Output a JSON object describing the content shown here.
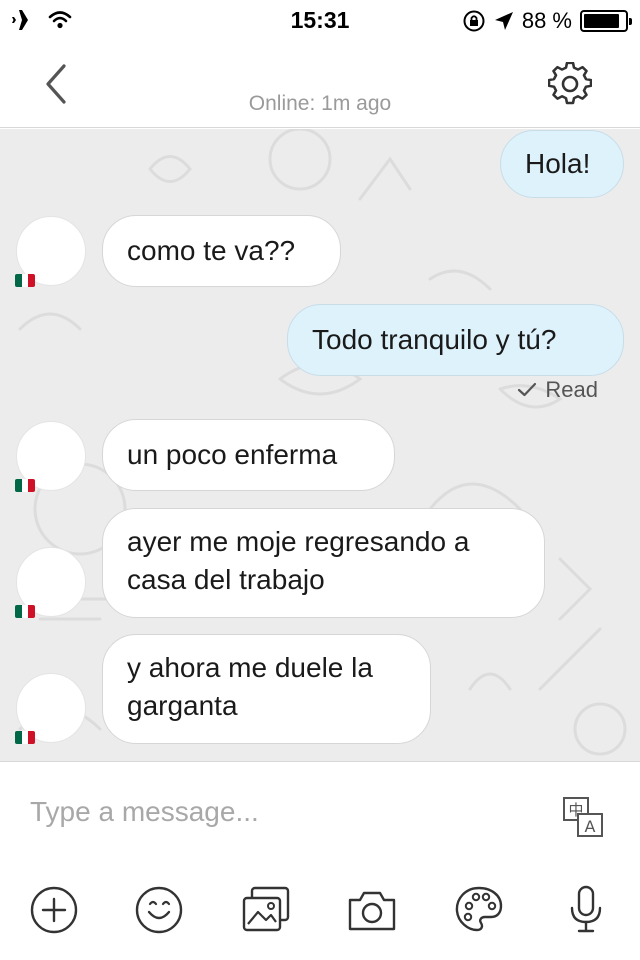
{
  "status_bar": {
    "time": "15:31",
    "battery_text": "88 %",
    "battery_level": 0.88,
    "icons": [
      "airplane-icon",
      "wifi-icon",
      "rotation-lock-icon",
      "location-arrow-icon",
      "battery-icon"
    ]
  },
  "header": {
    "status": "Online: 1m ago",
    "icons": [
      "chevron-left-icon",
      "gear-icon"
    ]
  },
  "messages": [
    {
      "direction": "out",
      "text": "Hola!"
    },
    {
      "direction": "in",
      "text": "como te va??"
    },
    {
      "direction": "out",
      "text": "Todo tranquilo y tú?"
    },
    {
      "direction": "in",
      "text": "un poco enferma"
    },
    {
      "direction": "in",
      "lines": [
        "ayer me moje regresando a",
        "casa del trabajo"
      ]
    },
    {
      "direction": "in",
      "lines": [
        "y ahora me duele la",
        "garganta"
      ]
    }
  ],
  "read_receipt": "Read",
  "composer": {
    "placeholder": "Type a message...",
    "translate_glyph_top": "中",
    "translate_glyph_bottom": "A"
  },
  "toolbar": {
    "icons": [
      "plus-circle-icon",
      "smiley-icon",
      "gallery-icon",
      "camera-icon",
      "palette-icon",
      "microphone-icon"
    ]
  },
  "colors": {
    "outgoing_bubble": "#def2fb",
    "incoming_bubble": "#ffffff",
    "chat_background": "#ececec",
    "flag_green": "#006847",
    "flag_white": "#ffffff",
    "flag_red": "#ce1126"
  }
}
